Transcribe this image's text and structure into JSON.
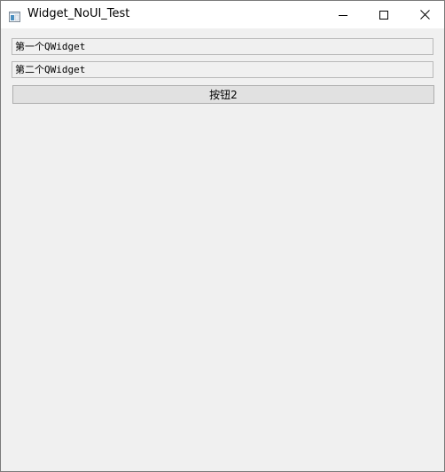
{
  "window": {
    "title": "Widget_NoUI_Test",
    "minimize_icon": "minimize-icon",
    "maximize_icon": "maximize-icon",
    "close_icon": "close-icon",
    "app_icon": "window-app-icon"
  },
  "content": {
    "widget1_label": "第一个QWidget",
    "widget2_label": "第二个QWidget",
    "button2_label": "按钮2"
  },
  "colors": {
    "client_background": "#f0f0f0",
    "titlebar_background": "#ffffff",
    "button_background": "#e1e1e1",
    "widget_border": "#b9b9b9"
  }
}
